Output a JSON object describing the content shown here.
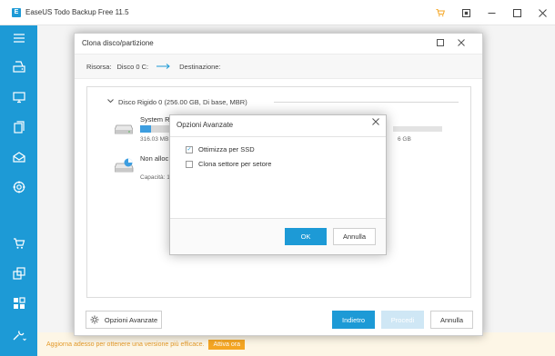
{
  "app": {
    "title": "EaseUS Todo Backup Free 11.5",
    "logo_letter": "E"
  },
  "titlebar_icons": [
    "cart-icon",
    "restore-window-icon",
    "minimize-icon",
    "maximize-icon",
    "close-icon"
  ],
  "sidebar": {
    "items": [
      {
        "icon": "hamburger-menu-icon"
      },
      {
        "icon": "disk-backup-icon"
      },
      {
        "icon": "system-backup-icon"
      },
      {
        "icon": "file-backup-icon"
      },
      {
        "icon": "mail-backup-icon"
      },
      {
        "icon": "smart-backup-icon"
      },
      {
        "icon": "cart-icon"
      },
      {
        "icon": "clone-icon"
      },
      {
        "icon": "tools-grid-icon"
      },
      {
        "icon": "wrench-icon"
      }
    ]
  },
  "promo": {
    "text": "Aggiorna adesso per ottenere una versione più efficace.",
    "button_label": "Attiva ora"
  },
  "clone_dialog": {
    "title": "Clona disco/partizione",
    "source_label": "Risorsa:",
    "source_value": "Disco 0 C:",
    "dest_label": "Destinazione:",
    "disk_header": "Disco Rigido 0 (256.00 GB, Di base, MBR)",
    "partitions": [
      {
        "name": "System R",
        "meta": "316.03 MB",
        "used_fraction": 0.33
      },
      {
        "name": "Non alloc",
        "meta": "Capacità: 1"
      }
    ],
    "right_text": "6 GB",
    "advanced_button": "Opzioni Avanzate",
    "back_button": "Indietro",
    "next_button": "Procedi",
    "cancel_button": "Annulla"
  },
  "advanced_modal": {
    "title": "Opzioni Avanzate",
    "options": [
      {
        "label": "Ottimizza per SSD",
        "checked": true
      },
      {
        "label": "Clona settore per setore",
        "checked": false
      }
    ],
    "ok_button": "OK",
    "cancel_button": "Annulla"
  },
  "colors": {
    "accent": "#1d9ad6",
    "promo_text": "#e39a2a",
    "promo_button": "#f5a623"
  }
}
